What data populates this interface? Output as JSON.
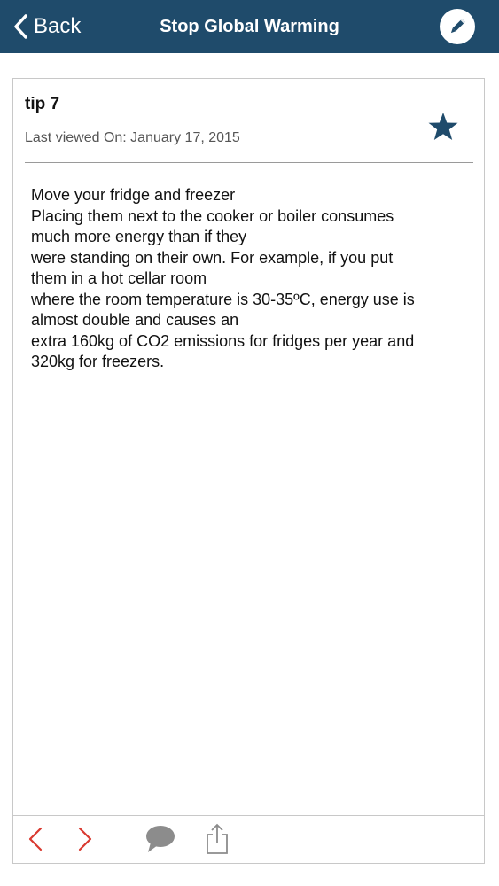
{
  "navbar": {
    "back_label": "Back",
    "title": "Stop Global Warming",
    "edit_icon": "pencil-icon"
  },
  "tip": {
    "title": "tip 7",
    "last_viewed": "Last viewed On: January 17, 2015",
    "favorite_icon": "star-icon",
    "body_lines": [
      "Move your fridge and freezer",
      "Placing them next to the cooker or boiler consumes",
      "much more energy than if they",
      "were standing on their own. For example, if you put",
      "them in a hot cellar room",
      "where the room temperature is 30-35ºC, energy use is",
      "almost double and causes an",
      "extra 160kg of CO2 emissions for fridges per year and",
      "320kg for freezers."
    ]
  },
  "toolbar": {
    "prev_icon": "chevron-left-icon",
    "next_icon": "chevron-right-icon",
    "comment_icon": "speech-bubble-icon",
    "share_icon": "share-icon"
  },
  "colors": {
    "navbar": "#1f4b6b",
    "accent_red": "#d9392f",
    "icon_gray": "#8c8c8c"
  }
}
